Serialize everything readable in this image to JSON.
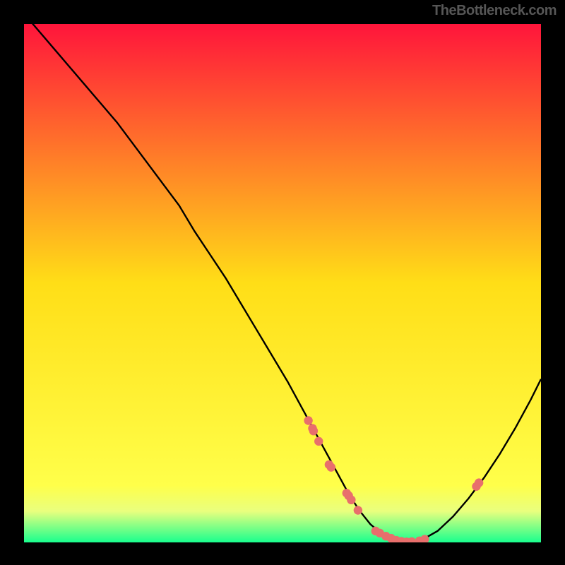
{
  "attribution": "TheBottleneck.com",
  "colors": {
    "page_bg": "#000000",
    "gradient": [
      {
        "offset": "0%",
        "color": "#ff153b"
      },
      {
        "offset": "50%",
        "color": "#ffde17"
      },
      {
        "offset": "89%",
        "color": "#ffff4a"
      },
      {
        "offset": "94%",
        "color": "#e9ff7e"
      },
      {
        "offset": "100%",
        "color": "#19ff8e"
      }
    ],
    "curve_stroke": "#000000",
    "dot_fill": "#e86f6c"
  },
  "chart_data": {
    "type": "line",
    "title": "",
    "xlabel": "",
    "ylabel": "",
    "xlim": [
      0,
      100
    ],
    "ylim": [
      0,
      100
    ],
    "x": [
      0,
      3,
      6,
      9,
      12,
      15,
      18,
      21,
      24,
      27,
      30,
      33,
      36,
      39,
      42,
      45,
      48,
      51,
      54,
      57,
      60,
      63,
      65,
      67,
      69,
      71,
      73,
      75,
      77,
      80,
      83,
      86,
      89,
      92,
      95,
      98,
      100
    ],
    "y": [
      102,
      98.5,
      95,
      91.5,
      88,
      84.5,
      81,
      77,
      73,
      69,
      65,
      60,
      55.5,
      51,
      46,
      41,
      36,
      31,
      25.5,
      20,
      14.5,
      9,
      6,
      3.5,
      1.8,
      0.7,
      0.15,
      0,
      0.5,
      2.2,
      5,
      8.5,
      12.5,
      17,
      22,
      27.5,
      31.5
    ],
    "series_dots": {
      "x": [
        55.0,
        55.8,
        56.0,
        57.0,
        59.0,
        59.4,
        62.4,
        62.8,
        63.3,
        64.6,
        68.0,
        68.8,
        70.0,
        71.0,
        72.0,
        73.0,
        74.0,
        75.0,
        76.5,
        77.5,
        87.5,
        88.0
      ],
      "y": [
        23.5,
        22.0,
        21.5,
        19.5,
        15.0,
        14.5,
        9.5,
        9.0,
        8.2,
        6.2,
        2.2,
        1.8,
        1.2,
        0.8,
        0.4,
        0.2,
        0.1,
        0.15,
        0.3,
        0.6,
        10.8,
        11.5
      ]
    }
  }
}
